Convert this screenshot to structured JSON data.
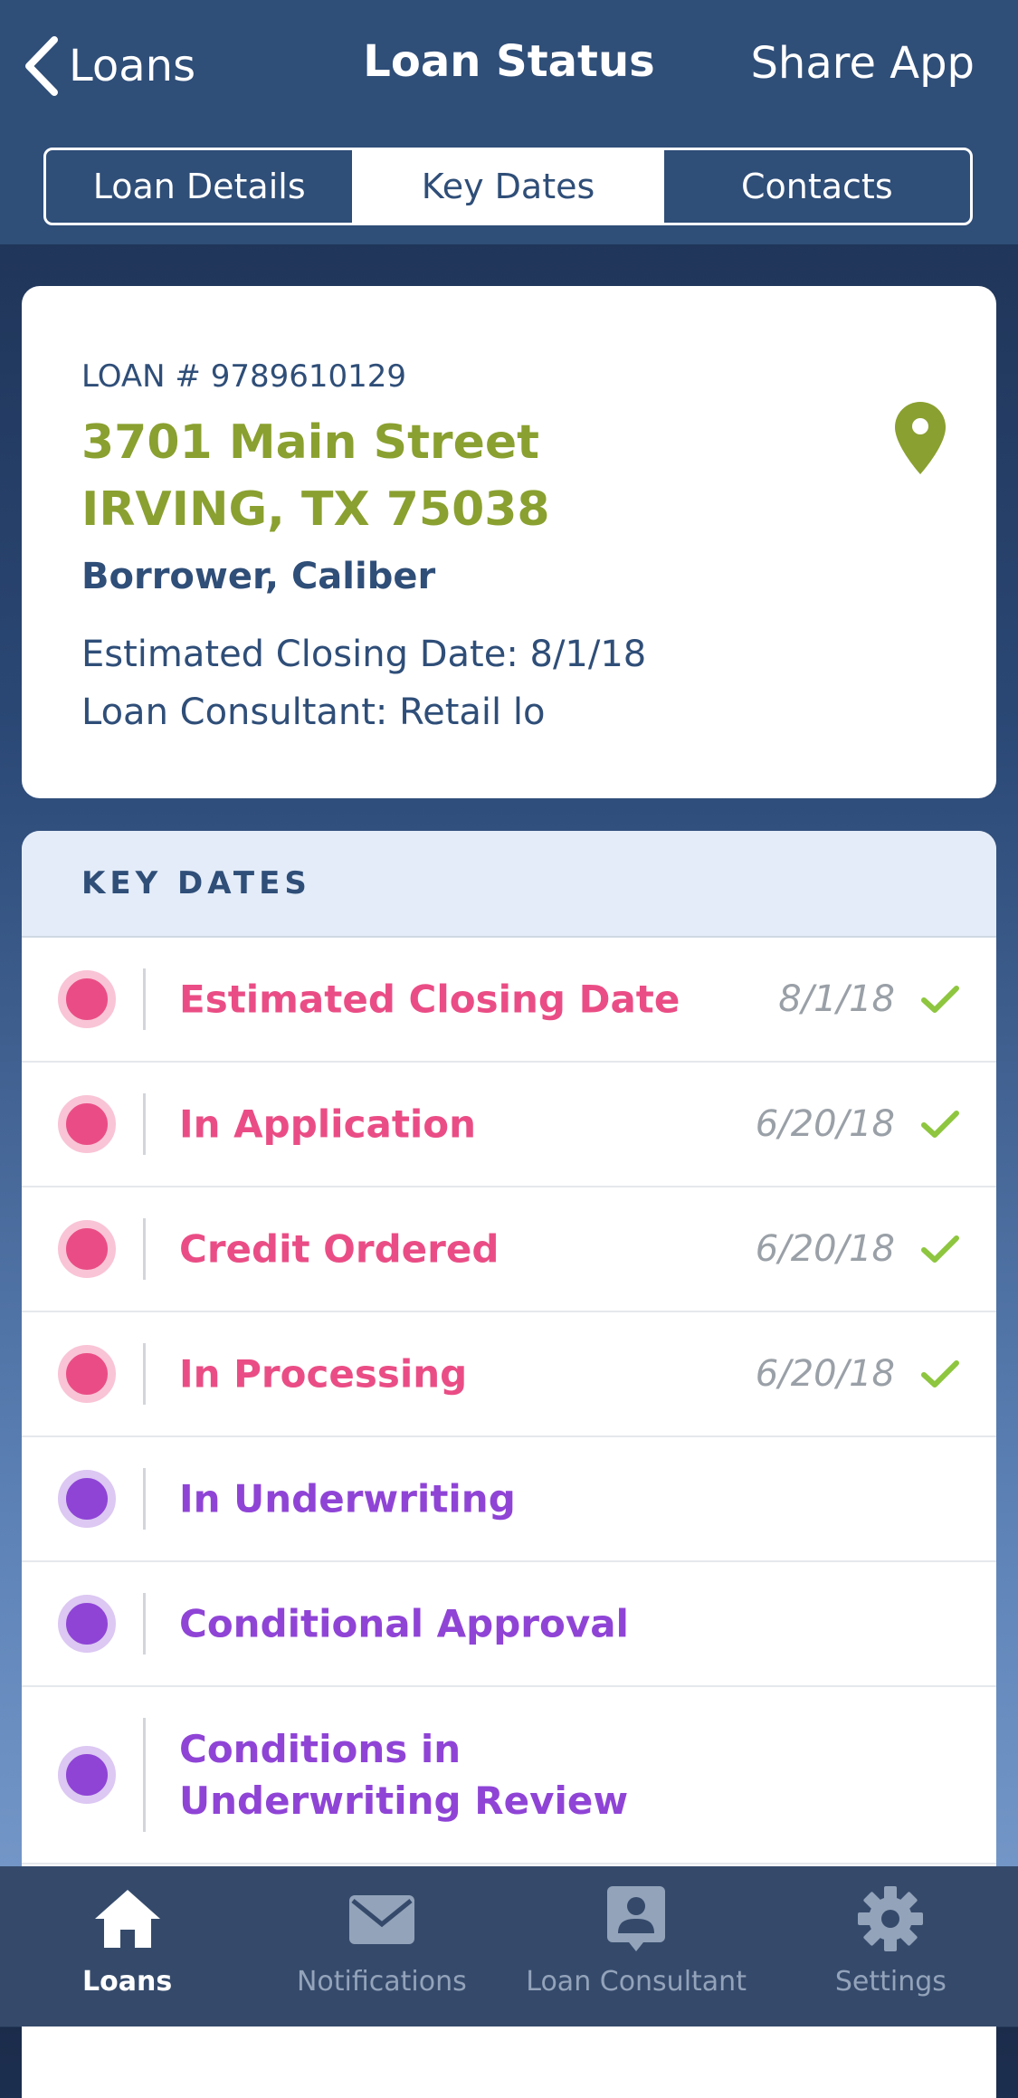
{
  "nav": {
    "back_label": "Loans",
    "title": "Loan Status",
    "share_label": "Share App"
  },
  "tabs": [
    {
      "label": "Loan Details",
      "active": false
    },
    {
      "label": "Key Dates",
      "active": true
    },
    {
      "label": "Contacts",
      "active": false
    }
  ],
  "loan": {
    "number": "LOAN # 9789610129",
    "address_line1": "3701 Main Street",
    "address_line2": "IRVING, TX 75038",
    "borrower": "Borrower, Caliber",
    "closing": "Estimated Closing Date: 8/1/18",
    "consultant": "Loan Consultant: Retail lo"
  },
  "key_dates": {
    "header": "KEY DATES",
    "items": [
      {
        "label": "Estimated Closing Date",
        "date": "8/1/18",
        "completed": true
      },
      {
        "label": "In Application",
        "date": "6/20/18",
        "completed": true
      },
      {
        "label": "Credit Ordered",
        "date": "6/20/18",
        "completed": true
      },
      {
        "label": "In Processing",
        "date": "6/20/18",
        "completed": true
      },
      {
        "label": "In Underwriting",
        "date": "",
        "completed": false
      },
      {
        "label": "Conditional Approval",
        "date": "",
        "completed": false
      },
      {
        "label": "Conditions in",
        "label2": "Underwriting Review",
        "date": "",
        "completed": false
      }
    ]
  },
  "bottom_tabs": [
    {
      "label": "Loans",
      "icon": "home-icon",
      "active": true
    },
    {
      "label": "Notifications",
      "icon": "envelope-icon",
      "active": false
    },
    {
      "label": "Loan Consultant",
      "icon": "contact-card-icon",
      "active": false
    },
    {
      "label": "Settings",
      "icon": "gear-icon",
      "active": false
    }
  ],
  "colors": {
    "header_bg": "#2f4e78",
    "address_green": "#8aa030",
    "completed_pink": "#ea4d85",
    "pending_purple": "#8f44d6",
    "check_green": "#8ec63f",
    "tabbar_bg": "#354a6b"
  }
}
